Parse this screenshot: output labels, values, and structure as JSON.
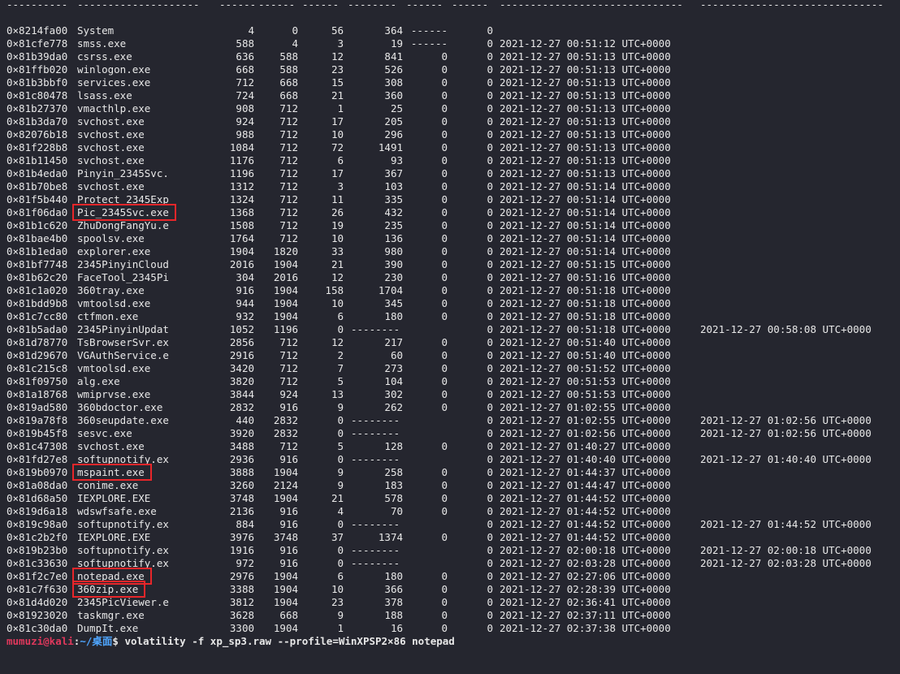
{
  "terminal": {
    "header_dashes": [
      "----------",
      "--------------------",
      "------",
      "------",
      "------",
      "--------",
      "------",
      "------",
      "------------------------------",
      "------------------------------"
    ],
    "rows": [
      {
        "offset": "0×8214fa00",
        "name": "System",
        "pid": "4",
        "ppid": "0",
        "thds": "56",
        "hnds": "364",
        "sess": "------",
        "wow64": "0",
        "start": "",
        "exit": ""
      },
      {
        "offset": "0×81cfe778",
        "name": "smss.exe",
        "pid": "588",
        "ppid": "4",
        "thds": "3",
        "hnds": "19",
        "sess": "------",
        "wow64": "0",
        "start": "2021-12-27 00:51:12 UTC+0000",
        "exit": ""
      },
      {
        "offset": "0×81b39da0",
        "name": "csrss.exe",
        "pid": "636",
        "ppid": "588",
        "thds": "12",
        "hnds": "841",
        "sess": "0",
        "wow64": "0",
        "start": "2021-12-27 00:51:13 UTC+0000",
        "exit": ""
      },
      {
        "offset": "0×81ffb020",
        "name": "winlogon.exe",
        "pid": "668",
        "ppid": "588",
        "thds": "23",
        "hnds": "526",
        "sess": "0",
        "wow64": "0",
        "start": "2021-12-27 00:51:13 UTC+0000",
        "exit": ""
      },
      {
        "offset": "0×81b3bbf0",
        "name": "services.exe",
        "pid": "712",
        "ppid": "668",
        "thds": "15",
        "hnds": "308",
        "sess": "0",
        "wow64": "0",
        "start": "2021-12-27 00:51:13 UTC+0000",
        "exit": ""
      },
      {
        "offset": "0×81c80478",
        "name": "lsass.exe",
        "pid": "724",
        "ppid": "668",
        "thds": "21",
        "hnds": "360",
        "sess": "0",
        "wow64": "0",
        "start": "2021-12-27 00:51:13 UTC+0000",
        "exit": ""
      },
      {
        "offset": "0×81b27370",
        "name": "vmacthlp.exe",
        "pid": "908",
        "ppid": "712",
        "thds": "1",
        "hnds": "25",
        "sess": "0",
        "wow64": "0",
        "start": "2021-12-27 00:51:13 UTC+0000",
        "exit": ""
      },
      {
        "offset": "0×81b3da70",
        "name": "svchost.exe",
        "pid": "924",
        "ppid": "712",
        "thds": "17",
        "hnds": "205",
        "sess": "0",
        "wow64": "0",
        "start": "2021-12-27 00:51:13 UTC+0000",
        "exit": ""
      },
      {
        "offset": "0×82076b18",
        "name": "svchost.exe",
        "pid": "988",
        "ppid": "712",
        "thds": "10",
        "hnds": "296",
        "sess": "0",
        "wow64": "0",
        "start": "2021-12-27 00:51:13 UTC+0000",
        "exit": ""
      },
      {
        "offset": "0×81f228b8",
        "name": "svchost.exe",
        "pid": "1084",
        "ppid": "712",
        "thds": "72",
        "hnds": "1491",
        "sess": "0",
        "wow64": "0",
        "start": "2021-12-27 00:51:13 UTC+0000",
        "exit": ""
      },
      {
        "offset": "0×81b11450",
        "name": "svchost.exe",
        "pid": "1176",
        "ppid": "712",
        "thds": "6",
        "hnds": "93",
        "sess": "0",
        "wow64": "0",
        "start": "2021-12-27 00:51:13 UTC+0000",
        "exit": ""
      },
      {
        "offset": "0×81b4eda0",
        "name": "Pinyin_2345Svc.",
        "pid": "1196",
        "ppid": "712",
        "thds": "17",
        "hnds": "367",
        "sess": "0",
        "wow64": "0",
        "start": "2021-12-27 00:51:13 UTC+0000",
        "exit": ""
      },
      {
        "offset": "0×81b70be8",
        "name": "svchost.exe",
        "pid": "1312",
        "ppid": "712",
        "thds": "3",
        "hnds": "103",
        "sess": "0",
        "wow64": "0",
        "start": "2021-12-27 00:51:14 UTC+0000",
        "exit": ""
      },
      {
        "offset": "0×81f5b440",
        "name": "Protect_2345Exp",
        "pid": "1324",
        "ppid": "712",
        "thds": "11",
        "hnds": "335",
        "sess": "0",
        "wow64": "0",
        "start": "2021-12-27 00:51:14 UTC+0000",
        "exit": ""
      },
      {
        "offset": "0×81f06da0",
        "name": "Pic_2345Svc.exe",
        "pid": "1368",
        "ppid": "712",
        "thds": "26",
        "hnds": "432",
        "sess": "0",
        "wow64": "0",
        "start": "2021-12-27 00:51:14 UTC+0000",
        "exit": "",
        "highlight": true
      },
      {
        "offset": "0×81b1c620",
        "name": "ZhuDongFangYu.e",
        "pid": "1508",
        "ppid": "712",
        "thds": "19",
        "hnds": "235",
        "sess": "0",
        "wow64": "0",
        "start": "2021-12-27 00:51:14 UTC+0000",
        "exit": ""
      },
      {
        "offset": "0×81bae4b0",
        "name": "spoolsv.exe",
        "pid": "1764",
        "ppid": "712",
        "thds": "10",
        "hnds": "136",
        "sess": "0",
        "wow64": "0",
        "start": "2021-12-27 00:51:14 UTC+0000",
        "exit": ""
      },
      {
        "offset": "0×81b1eda0",
        "name": "explorer.exe",
        "pid": "1904",
        "ppid": "1820",
        "thds": "33",
        "hnds": "980",
        "sess": "0",
        "wow64": "0",
        "start": "2021-12-27 00:51:14 UTC+0000",
        "exit": ""
      },
      {
        "offset": "0×81bf7748",
        "name": "2345PinyinCloud",
        "pid": "2016",
        "ppid": "1904",
        "thds": "21",
        "hnds": "390",
        "sess": "0",
        "wow64": "0",
        "start": "2021-12-27 00:51:15 UTC+0000",
        "exit": ""
      },
      {
        "offset": "0×81b62c20",
        "name": "FaceTool_2345Pi",
        "pid": "304",
        "ppid": "2016",
        "thds": "12",
        "hnds": "230",
        "sess": "0",
        "wow64": "0",
        "start": "2021-12-27 00:51:16 UTC+0000",
        "exit": ""
      },
      {
        "offset": "0×81c1a020",
        "name": "360tray.exe",
        "pid": "916",
        "ppid": "1904",
        "thds": "158",
        "hnds": "1704",
        "sess": "0",
        "wow64": "0",
        "start": "2021-12-27 00:51:18 UTC+0000",
        "exit": ""
      },
      {
        "offset": "0×81bdd9b8",
        "name": "vmtoolsd.exe",
        "pid": "944",
        "ppid": "1904",
        "thds": "10",
        "hnds": "345",
        "sess": "0",
        "wow64": "0",
        "start": "2021-12-27 00:51:18 UTC+0000",
        "exit": ""
      },
      {
        "offset": "0×81c7cc80",
        "name": "ctfmon.exe",
        "pid": "932",
        "ppid": "1904",
        "thds": "6",
        "hnds": "180",
        "sess": "0",
        "wow64": "0",
        "start": "2021-12-27 00:51:18 UTC+0000",
        "exit": ""
      },
      {
        "offset": "0×81b5ada0",
        "name": "2345PinyinUpdat",
        "pid": "1052",
        "ppid": "1196",
        "thds": "0",
        "hnds": "--------",
        "sess": "",
        "wow64": "0",
        "start": "2021-12-27 00:51:18 UTC+0000",
        "exit": "2021-12-27 00:58:08 UTC+0000"
      },
      {
        "offset": "0×81d78770",
        "name": "TsBrowserSvr.ex",
        "pid": "2856",
        "ppid": "712",
        "thds": "12",
        "hnds": "217",
        "sess": "0",
        "wow64": "0",
        "start": "2021-12-27 00:51:40 UTC+0000",
        "exit": ""
      },
      {
        "offset": "0×81d29670",
        "name": "VGAuthService.e",
        "pid": "2916",
        "ppid": "712",
        "thds": "2",
        "hnds": "60",
        "sess": "0",
        "wow64": "0",
        "start": "2021-12-27 00:51:40 UTC+0000",
        "exit": ""
      },
      {
        "offset": "0×81c215c8",
        "name": "vmtoolsd.exe",
        "pid": "3420",
        "ppid": "712",
        "thds": "7",
        "hnds": "273",
        "sess": "0",
        "wow64": "0",
        "start": "2021-12-27 00:51:52 UTC+0000",
        "exit": ""
      },
      {
        "offset": "0×81f09750",
        "name": "alg.exe",
        "pid": "3820",
        "ppid": "712",
        "thds": "5",
        "hnds": "104",
        "sess": "0",
        "wow64": "0",
        "start": "2021-12-27 00:51:53 UTC+0000",
        "exit": ""
      },
      {
        "offset": "0×81a18768",
        "name": "wmiprvse.exe",
        "pid": "3844",
        "ppid": "924",
        "thds": "13",
        "hnds": "302",
        "sess": "0",
        "wow64": "0",
        "start": "2021-12-27 00:51:53 UTC+0000",
        "exit": ""
      },
      {
        "offset": "0×819ad580",
        "name": "360bdoctor.exe",
        "pid": "2832",
        "ppid": "916",
        "thds": "9",
        "hnds": "262",
        "sess": "0",
        "wow64": "0",
        "start": "2021-12-27 01:02:55 UTC+0000",
        "exit": ""
      },
      {
        "offset": "0×819a78f8",
        "name": "360seupdate.exe",
        "pid": "440",
        "ppid": "2832",
        "thds": "0",
        "hnds": "--------",
        "sess": "",
        "wow64": "0",
        "start": "2021-12-27 01:02:55 UTC+0000",
        "exit": "2021-12-27 01:02:56 UTC+0000"
      },
      {
        "offset": "0×819b45f8",
        "name": "sesvc.exe",
        "pid": "3920",
        "ppid": "2832",
        "thds": "0",
        "hnds": "--------",
        "sess": "",
        "wow64": "0",
        "start": "2021-12-27 01:02:56 UTC+0000",
        "exit": "2021-12-27 01:02:56 UTC+0000"
      },
      {
        "offset": "0×81c47308",
        "name": "svchost.exe",
        "pid": "3488",
        "ppid": "712",
        "thds": "5",
        "hnds": "128",
        "sess": "0",
        "wow64": "0",
        "start": "2021-12-27 01:40:27 UTC+0000",
        "exit": ""
      },
      {
        "offset": "0×81fd27e8",
        "name": "softupnotify.ex",
        "pid": "2936",
        "ppid": "916",
        "thds": "0",
        "hnds": "--------",
        "sess": "",
        "wow64": "0",
        "start": "2021-12-27 01:40:40 UTC+0000",
        "exit": "2021-12-27 01:40:40 UTC+0000"
      },
      {
        "offset": "0×819b0970",
        "name": "mspaint.exe",
        "pid": "3888",
        "ppid": "1904",
        "thds": "9",
        "hnds": "258",
        "sess": "0",
        "wow64": "0",
        "start": "2021-12-27 01:44:37 UTC+0000",
        "exit": "",
        "highlight": true
      },
      {
        "offset": "0×81a08da0",
        "name": "conime.exe",
        "pid": "3260",
        "ppid": "2124",
        "thds": "9",
        "hnds": "183",
        "sess": "0",
        "wow64": "0",
        "start": "2021-12-27 01:44:47 UTC+0000",
        "exit": ""
      },
      {
        "offset": "0×81d68a50",
        "name": "IEXPLORE.EXE",
        "pid": "3748",
        "ppid": "1904",
        "thds": "21",
        "hnds": "578",
        "sess": "0",
        "wow64": "0",
        "start": "2021-12-27 01:44:52 UTC+0000",
        "exit": ""
      },
      {
        "offset": "0×819d6a18",
        "name": "wdswfsafe.exe",
        "pid": "2136",
        "ppid": "916",
        "thds": "4",
        "hnds": "70",
        "sess": "0",
        "wow64": "0",
        "start": "2021-12-27 01:44:52 UTC+0000",
        "exit": ""
      },
      {
        "offset": "0×819c98a0",
        "name": "softupnotify.ex",
        "pid": "884",
        "ppid": "916",
        "thds": "0",
        "hnds": "--------",
        "sess": "",
        "wow64": "0",
        "start": "2021-12-27 01:44:52 UTC+0000",
        "exit": "2021-12-27 01:44:52 UTC+0000"
      },
      {
        "offset": "0×81c2b2f0",
        "name": "IEXPLORE.EXE",
        "pid": "3976",
        "ppid": "3748",
        "thds": "37",
        "hnds": "1374",
        "sess": "0",
        "wow64": "0",
        "start": "2021-12-27 01:44:52 UTC+0000",
        "exit": ""
      },
      {
        "offset": "0×819b23b0",
        "name": "softupnotify.ex",
        "pid": "1916",
        "ppid": "916",
        "thds": "0",
        "hnds": "--------",
        "sess": "",
        "wow64": "0",
        "start": "2021-12-27 02:00:18 UTC+0000",
        "exit": "2021-12-27 02:00:18 UTC+0000"
      },
      {
        "offset": "0×81c33630",
        "name": "softupnotify.ex",
        "pid": "972",
        "ppid": "916",
        "thds": "0",
        "hnds": "--------",
        "sess": "",
        "wow64": "0",
        "start": "2021-12-27 02:03:28 UTC+0000",
        "exit": "2021-12-27 02:03:28 UTC+0000"
      },
      {
        "offset": "0×81f2c7e0",
        "name": "notepad.exe",
        "pid": "2976",
        "ppid": "1904",
        "thds": "6",
        "hnds": "180",
        "sess": "0",
        "wow64": "0",
        "start": "2021-12-27 02:27:06 UTC+0000",
        "exit": "",
        "highlight": true
      },
      {
        "offset": "0×81c7f630",
        "name": "360zip.exe",
        "pid": "3388",
        "ppid": "1904",
        "thds": "10",
        "hnds": "366",
        "sess": "0",
        "wow64": "0",
        "start": "2021-12-27 02:28:39 UTC+0000",
        "exit": "",
        "highlight": true
      },
      {
        "offset": "0×81d4d020",
        "name": "2345PicViewer.e",
        "pid": "3812",
        "ppid": "1904",
        "thds": "23",
        "hnds": "378",
        "sess": "0",
        "wow64": "0",
        "start": "2021-12-27 02:36:41 UTC+0000",
        "exit": ""
      },
      {
        "offset": "0×81923020",
        "name": "taskmgr.exe",
        "pid": "3628",
        "ppid": "668",
        "thds": "9",
        "hnds": "188",
        "sess": "0",
        "wow64": "0",
        "start": "2021-12-27 02:37:11 UTC+0000",
        "exit": ""
      },
      {
        "offset": "0×81c30da0",
        "name": "DumpIt.exe",
        "pid": "3300",
        "ppid": "1904",
        "thds": "1",
        "hnds": "16",
        "sess": "0",
        "wow64": "0",
        "start": "2021-12-27 02:37:38 UTC+0000",
        "exit": ""
      }
    ],
    "prompt": {
      "user_host": "mumuzi@kali",
      "separator": ":",
      "path": "~/桌面",
      "symbol": "$",
      "command": " volatility -f xp_sp3.raw --profile=WinXPSP2×86 notepad"
    }
  },
  "colors": {
    "background": "#25262f",
    "text": "#e8e8e8",
    "highlight_box": "#e8262a",
    "prompt_user": "#e0385c",
    "prompt_path": "#4fa6ff"
  }
}
